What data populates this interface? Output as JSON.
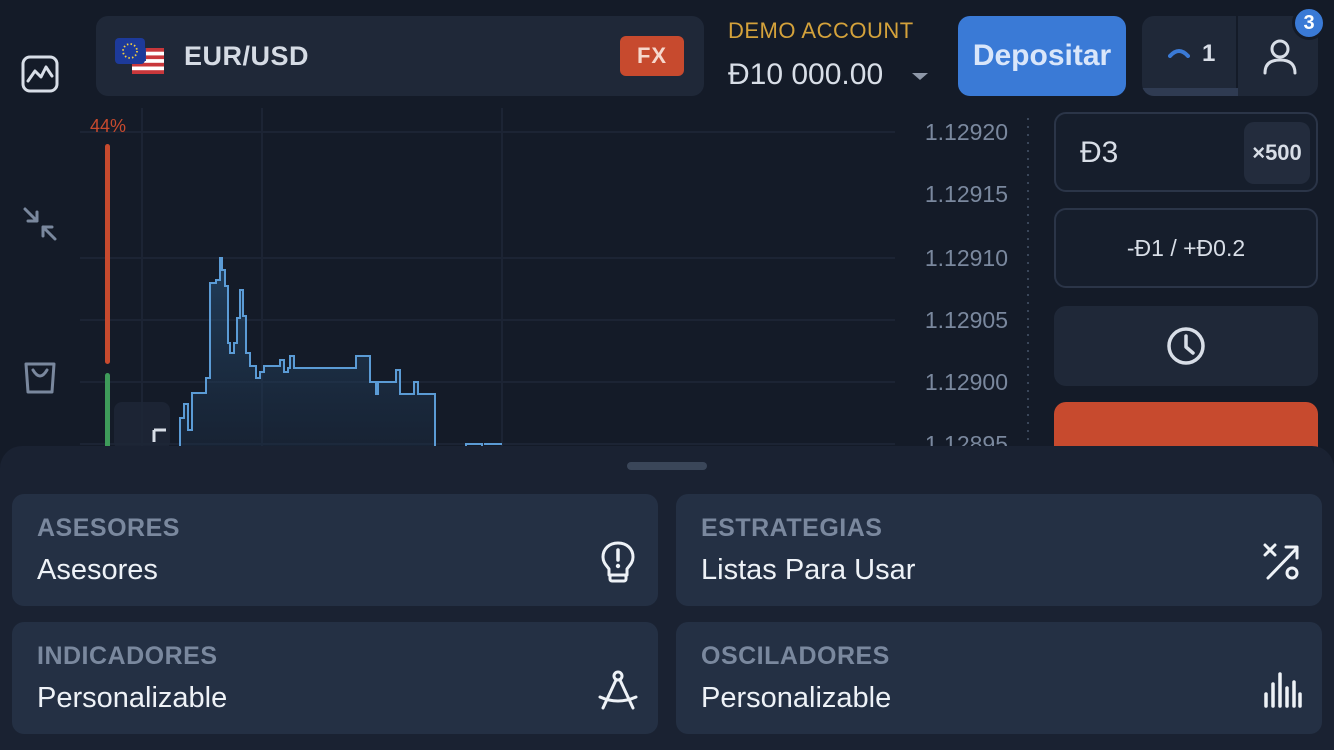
{
  "asset": {
    "name": "EUR/USD",
    "type_badge": "FX"
  },
  "account": {
    "label": "DEMO ACCOUNT",
    "balance": "Đ10 000.00"
  },
  "header": {
    "deposit_label": "Depositar",
    "open_trades": "1",
    "notifications": "3"
  },
  "chart": {
    "sentiment_pct": "44%",
    "price_ticks": [
      "1.12920",
      "1.12915",
      "1.12910",
      "1.12905",
      "1.12900",
      "1.12895"
    ]
  },
  "trade": {
    "amount": "Đ3",
    "multiplier": "×500",
    "profit_range": "-Đ1 / +Đ0.2"
  },
  "sheet": {
    "cards": [
      {
        "label": "ASESORES",
        "value": "Asesores",
        "icon": "lightbulb-icon"
      },
      {
        "label": "ESTRATEGIAS",
        "value": "Listas Para Usar",
        "icon": "strategy-icon"
      },
      {
        "label": "INDICADORES",
        "value": "Personalizable",
        "icon": "compass-icon"
      },
      {
        "label": "OSCILADORES",
        "value": "Personalizable",
        "icon": "bars-icon"
      }
    ]
  },
  "colors": {
    "accent_blue": "#3a7ad6",
    "sell_red": "#c74a2e",
    "buy_green": "#3e9b5a",
    "demo_gold": "#d4a23b"
  }
}
